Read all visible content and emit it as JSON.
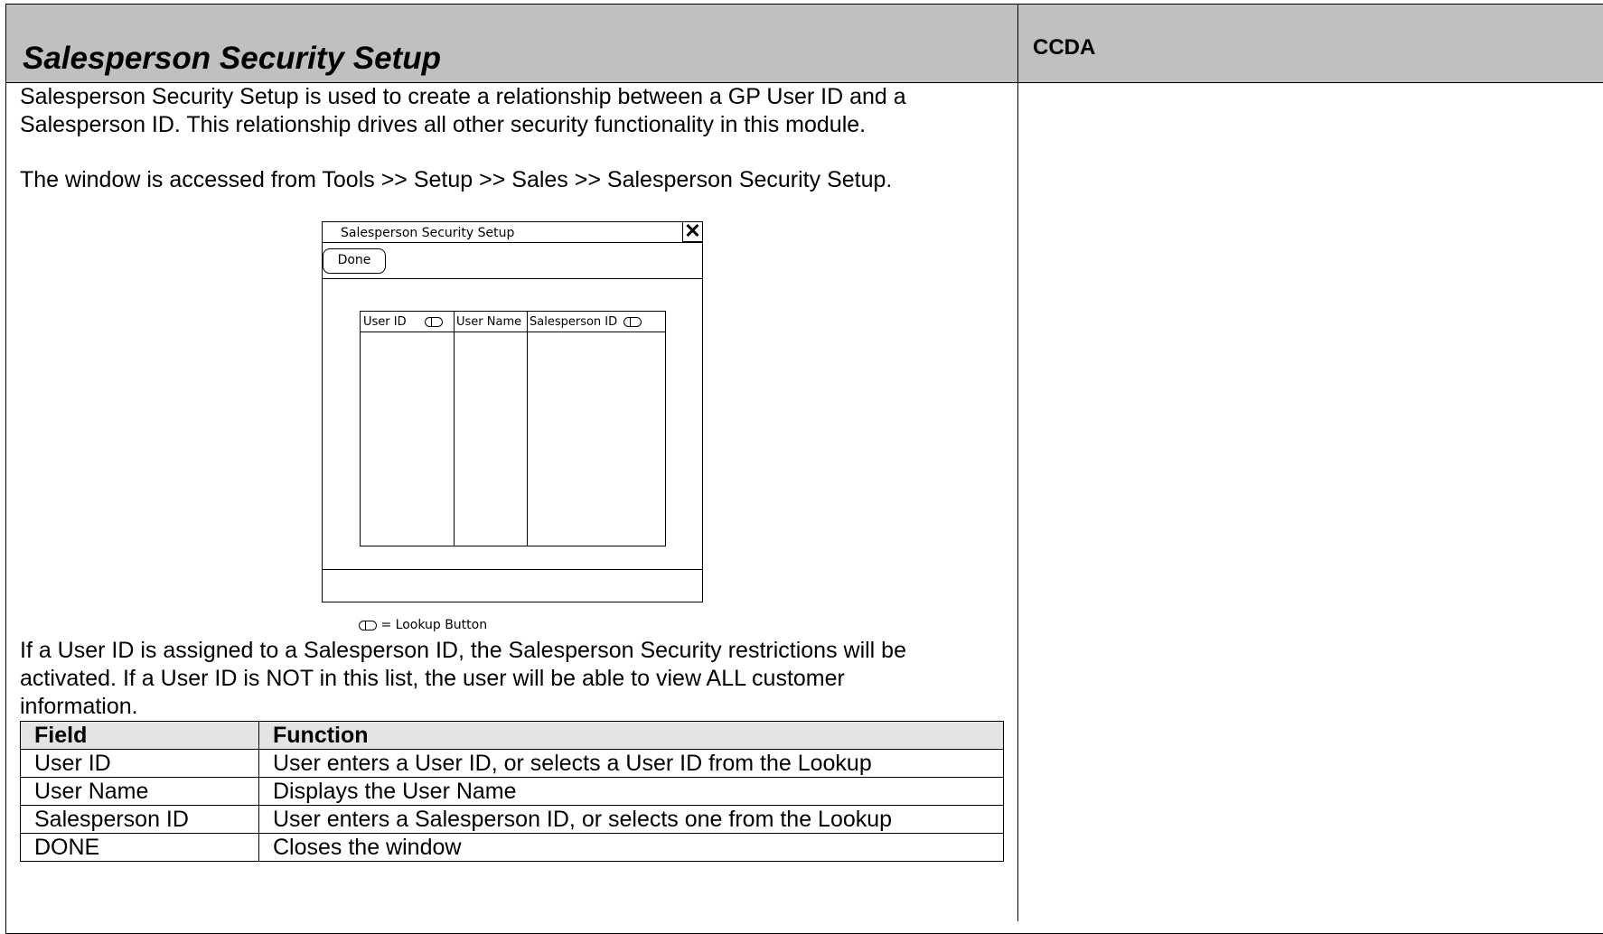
{
  "header": {
    "title": "Salesperson Security Setup",
    "tag": "CCDA"
  },
  "body": {
    "intro": "Salesperson Security Setup is used to create a relationship between a GP User ID and a\nSalesperson ID.  This relationship drives all other security functionality in this module.",
    "access": "The window is accessed from Tools >> Setup >> Sales >> Salesperson Security Setup.",
    "note": "If a User ID is assigned to a Salesperson ID, the Salesperson Security restrictions will be\nactivated.  If a User ID is NOT in this list, the user will be able to view ALL customer\ninformation."
  },
  "mock_window": {
    "title": "Salesperson Security Setup",
    "close_glyph": "✕",
    "done_label": "Done",
    "columns": [
      "User ID",
      "User Name",
      "Salesperson ID"
    ],
    "legend": "= Lookup Button"
  },
  "field_table": {
    "headers": [
      "Field",
      "Function"
    ],
    "rows": [
      [
        "User ID",
        "User enters a User ID, or selects a User ID from the Lookup"
      ],
      [
        "User Name",
        "Displays the User Name"
      ],
      [
        "Salesperson ID",
        "User enters a Salesperson ID, or selects one from the Lookup"
      ],
      [
        "DONE",
        "Closes the window"
      ]
    ]
  }
}
